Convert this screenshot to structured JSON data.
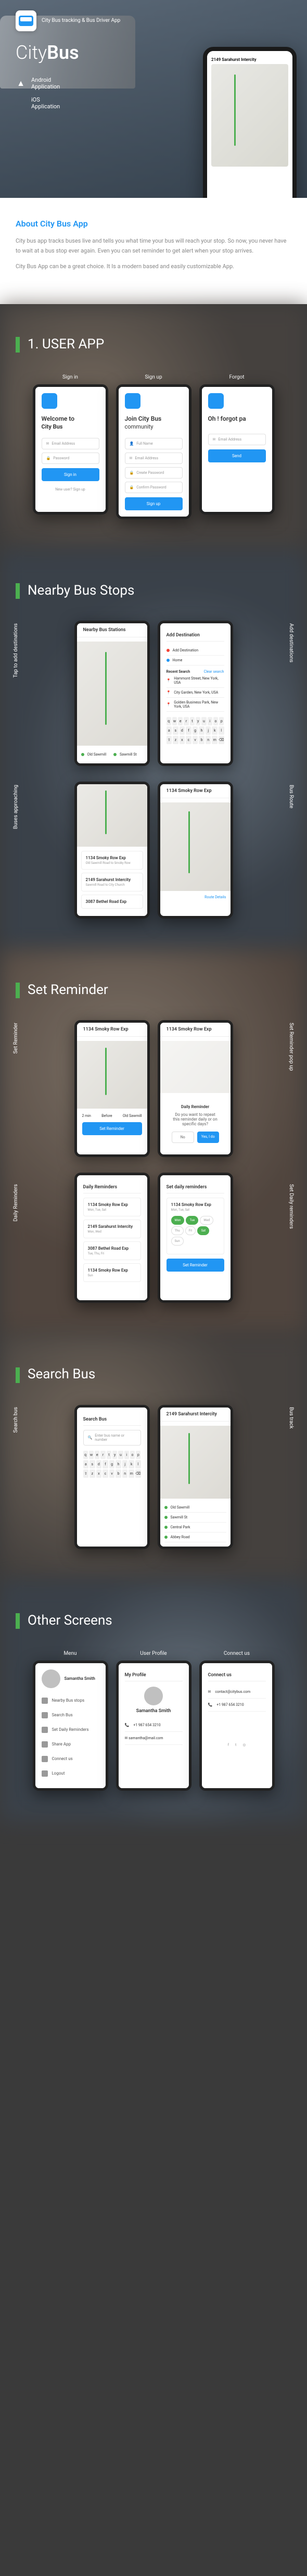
{
  "hero": {
    "tagline": "City Bus tracking &\nBus Driver App",
    "title_light": "City",
    "title_bold": "Bus",
    "platforms": [
      {
        "name": "Android",
        "sub": "Application"
      },
      {
        "name": "iOS",
        "sub": "Application"
      }
    ]
  },
  "about": {
    "heading": "About City Bus App",
    "para1": "City bus app tracks buses live and tells you what time your bus will reach your stop. So now, you never have to wait at a bus stop ever again. Even you can set reminder to get alert when your stop arrives.",
    "para2": "City Bus App can be a great choice. It Is a modern based and easily customizable App."
  },
  "s1": {
    "title": "1. USER APP",
    "cols": [
      "Sign in",
      "Sign up",
      "Forgot"
    ],
    "signin": {
      "welcome": "Welcome to",
      "brand": "City Bus",
      "email": "Email Address",
      "pwd": "Password",
      "btn": "Sign in",
      "link": "New user? Sign up"
    },
    "signup": {
      "welcome": "Join City Bus",
      "sub": "community",
      "name": "Full Name",
      "email": "Email Address",
      "pwd": "Create Password",
      "cpwd": "Confirm Password",
      "btn": "Sign up"
    },
    "forgot": {
      "title": "Oh ! forgot pa",
      "email": "Email Address",
      "btn": "Send"
    }
  },
  "s2": {
    "title": "Nearby Bus Stops",
    "left_label": "Tap to add destinations",
    "right_label": "Add destinations",
    "header": "Nearby Bus Stations",
    "add_dest": "Add Destination",
    "home": "Home",
    "recent": "Recent Search",
    "clear": "Clear search",
    "stops": [
      "Old Sawmill",
      "Sawmill St"
    ],
    "searches": [
      "Hammont Street, New York, USA",
      "City Garden, New York, USA",
      "Golden Business Park, New York, USA"
    ]
  },
  "s3": {
    "left_label": "Buses approaching",
    "right_label": "Bus Route",
    "bus1": {
      "name": "1134 Smoky Row Exp",
      "route": "Old Sawmill Road to Smoky Row"
    },
    "bus2": {
      "name": "2149 Sarahurst Intercity",
      "route": "Sawmill Road to City Church"
    },
    "bus3": {
      "name": "3087 Bethel Road Exp"
    },
    "route_header": "1134 Smoky Row Exp",
    "route_action": "Route Details"
  },
  "s4": {
    "title": "Set Reminder",
    "left_label": "Set Reminder",
    "right_label": "Set Reminder pop up",
    "before": "Before",
    "mins": "2 min",
    "stop": "Old Sawmill",
    "btn": "Set Reminder",
    "popup_title": "Daily Reminder",
    "popup_text": "Do you want to repeat this reminder daily or on specific days?",
    "popup_no": "No",
    "popup_yes": "Yes, I do"
  },
  "s5": {
    "left_label": "Daily Reminders",
    "right_label": "Set Daily reminders",
    "header": "Daily Reminders",
    "set_header": "Set daily reminders",
    "days": [
      "Mon",
      "Tue",
      "Wed",
      "Thu",
      "Fri",
      "Sat",
      "Sun"
    ],
    "reminders": [
      {
        "name": "1134 Smoky Row Exp",
        "days": "Mon, Tue, Sat"
      },
      {
        "name": "2149 Sarahurst Intercity",
        "days": "Mon, Wed"
      },
      {
        "name": "3087 Bethel Road Exp",
        "days": "Tue, Thu, Fri"
      },
      {
        "name": "1134 Smoky Row Exp",
        "days": "Sun"
      }
    ],
    "btn": "Set Reminder"
  },
  "s6": {
    "title": "Search Bus",
    "left_label": "Search bus",
    "right_label": "Bus track",
    "header": "Search Bus",
    "placeholder": "Enter bus name or number",
    "result_title": "2149 Sarahurst Intercity",
    "stops": [
      "Old Sawmill",
      "Sawmill St",
      "Central Park",
      "Abbey Road"
    ]
  },
  "s7": {
    "title": "Other Screens",
    "cols": [
      "Menu",
      "User Profile",
      "Connect us"
    ],
    "user_name": "Samantha Smith",
    "phone": "+1 987 654 3210",
    "menu": [
      "Nearby Bus stops",
      "Search Bus",
      "Set Daily Reminders",
      "Share App",
      "Connect us",
      "Logout"
    ],
    "profile_header": "My Profile",
    "connect_header": "Connect us",
    "contact_email": "contact@citybus.com",
    "contact_phone": "+1 987 654 3210"
  }
}
